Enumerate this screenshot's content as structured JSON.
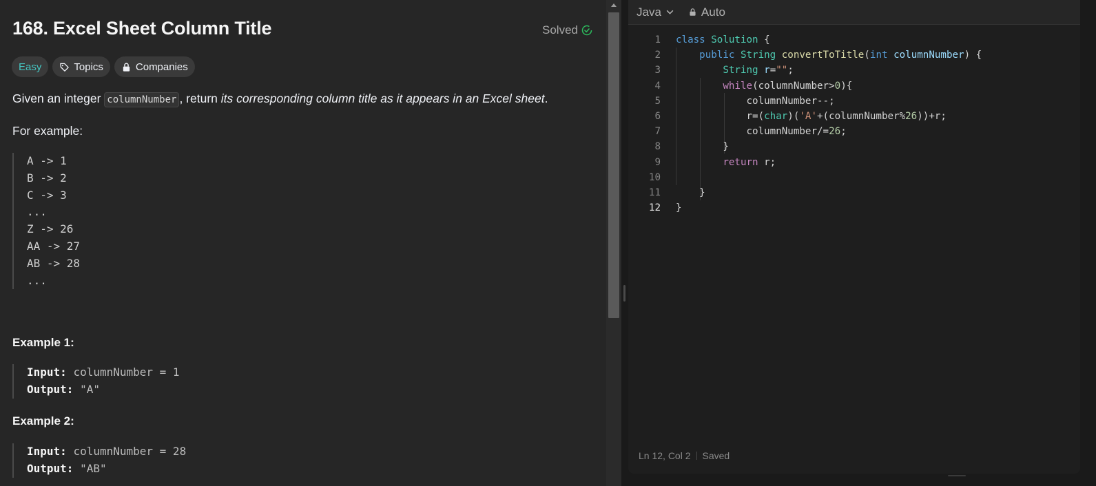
{
  "problem": {
    "title": "168. Excel Sheet Column Title",
    "status": "Solved",
    "tags": {
      "difficulty": "Easy",
      "topics": "Topics",
      "companies": "Companies"
    },
    "intro_pre": "Given an integer ",
    "intro_code": "columnNumber",
    "intro_mid": ", return ",
    "intro_em": "its corresponding column title as it appears in an Excel sheet",
    "intro_post": ".",
    "for_example": "For example:",
    "mapping_lines": [
      "A -> 1",
      "B -> 2",
      "C -> 3",
      "...",
      "Z -> 26",
      "AA -> 27",
      "AB -> 28",
      "..."
    ],
    "examples": [
      {
        "heading": "Example 1:",
        "input_label": "Input:",
        "input_value": "columnNumber = 1",
        "output_label": "Output:",
        "output_value": "\"A\""
      },
      {
        "heading": "Example 2:",
        "input_label": "Input:",
        "input_value": "columnNumber = 28",
        "output_label": "Output:",
        "output_value": "\"AB\""
      }
    ]
  },
  "editor": {
    "language": "Java",
    "mode": "Auto",
    "line_numbers": [
      "1",
      "2",
      "3",
      "4",
      "5",
      "6",
      "7",
      "8",
      "9",
      "10",
      "11",
      "12"
    ],
    "status_position": "Ln 12, Col 2",
    "status_saved": "Saved"
  },
  "colors": {
    "easy": "#46c6c2",
    "solved_check": "#2cbb5d",
    "keyword": "#569cd6",
    "control": "#c586c0",
    "type": "#4ec9b0",
    "function": "#dcdcaa",
    "string": "#ce9178",
    "number": "#b5cea8"
  },
  "icons": {
    "solved": "check-circle-icon",
    "topics": "tag-icon",
    "companies": "lock-icon",
    "language_dropdown": "chevron-down-icon",
    "mode": "lock-icon"
  }
}
